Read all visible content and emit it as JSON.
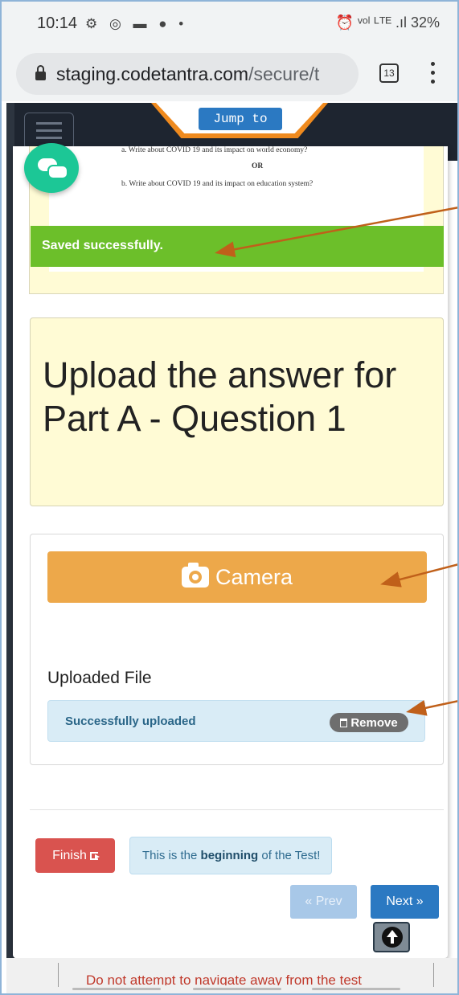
{
  "status_bar": {
    "time": "10:14",
    "left_icons": "⚙ ◎ ▬ ● •",
    "right_text": "⏰ ᵛᵒˡ ᴸᵀᴱ .ıl 32%",
    "battery": "32%"
  },
  "browser": {
    "url_host": "staging.codetantra.com",
    "url_path": "/secure/t",
    "tab_count": "13"
  },
  "header": {
    "jump_label": "Jump to"
  },
  "question": {
    "line_a": "a.  Write about COVID 19 and its impact on world economy?",
    "or": "OR",
    "line_b": "b.  Write about COVID 19 and its impact on education system?"
  },
  "alert": {
    "saved": "Saved successfully."
  },
  "upload": {
    "title": "Upload the answer for Part A - Question 1",
    "camera_label": "Camera",
    "uploaded_file_label": "Uploaded File",
    "status": "Successfully uploaded",
    "remove_label": "Remove"
  },
  "nav": {
    "finish_label": "Finish",
    "info_prefix": "This is the ",
    "info_bold": "beginning",
    "info_suffix": " of the Test!",
    "prev_label": "« Prev",
    "next_label": "Next »"
  },
  "footer": {
    "warning": "Do not attempt to navigate away from the test"
  },
  "colors": {
    "saved_green": "#6cbf2a",
    "camera_orange": "#eda84a",
    "annotation_arrow": "#c0601a",
    "primary_blue": "#2b79c2",
    "danger_red": "#d9534f",
    "chat_green": "#1cc796"
  }
}
